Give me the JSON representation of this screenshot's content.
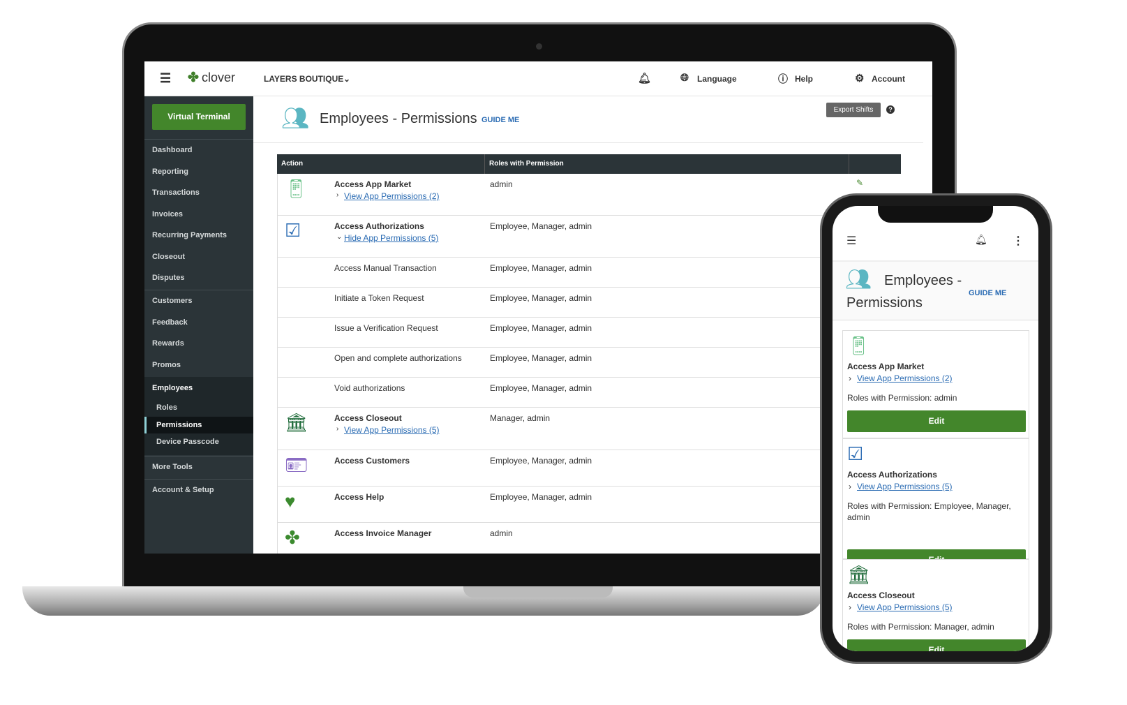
{
  "colors": {
    "brand_green": "#43862b",
    "sidebar": "#2b3438",
    "link": "#2a6bb3"
  },
  "topbar": {
    "merchant": "LAYERS BOUTIQUE",
    "logo": "clover",
    "language": "Language",
    "help": "Help",
    "account": "Account"
  },
  "sidebar": {
    "virtual_terminal": "Virtual Terminal",
    "items": [
      "Dashboard",
      "Reporting",
      "Transactions",
      "Invoices",
      "Recurring Payments",
      "Closeout",
      "Disputes",
      "Customers",
      "Feedback",
      "Rewards",
      "Promos",
      "Employees",
      "Roles",
      "Permissions",
      "Device Passcode",
      "More Tools",
      "Account & Setup"
    ],
    "active": "Permissions"
  },
  "page": {
    "title": "Employees - Permissions",
    "guide": "GUIDE ME",
    "export": "Export Shifts",
    "help_icon": "?"
  },
  "table": {
    "headers": [
      "Action",
      "Roles with Permission"
    ],
    "rows": [
      {
        "action": "Access App Market",
        "roles": "admin",
        "link": "View App Permissions (2)",
        "icon": "app-market"
      },
      {
        "action": "Access Authorizations",
        "roles": "Employee, Manager, admin",
        "link": "Hide App Permissions (5)",
        "icon": "authorization"
      },
      {
        "action": "Access Manual Transaction",
        "roles": "Employee, Manager, admin"
      },
      {
        "action": "Initiate a Token Request",
        "roles": "Employee, Manager, admin"
      },
      {
        "action": "Issue a Verification Request",
        "roles": "Employee, Manager, admin"
      },
      {
        "action": "Open and complete authorizations",
        "roles": "Employee, Manager, admin"
      },
      {
        "action": "Void authorizations",
        "roles": "Employee, Manager, admin"
      },
      {
        "action": "Access Closeout",
        "roles": "Manager, admin",
        "link": "View App Permissions (5)",
        "icon": "bank"
      },
      {
        "action": "Access Customers",
        "roles": "Employee, Manager, admin",
        "icon": "id-card"
      },
      {
        "action": "Access Help",
        "roles": "Employee, Manager, admin",
        "icon": "heart"
      },
      {
        "action": "Access Invoice Manager",
        "roles": "admin",
        "icon": "clover"
      }
    ]
  },
  "mobile": {
    "title1": "Employees -",
    "title2": "Permissions",
    "guide": "GUIDE ME",
    "edit": "Edit",
    "cards": [
      {
        "title": "Access App Market",
        "link": "View App Permissions (2)",
        "roles": "Roles with Permission: admin"
      },
      {
        "title": "Access Authorizations",
        "link": "View App Permissions (5)",
        "roles": "Roles with Permission: Employee, Manager, admin"
      },
      {
        "title": "Access Closeout",
        "link": "View App Permissions (5)",
        "roles": "Roles with Permission: Manager, admin"
      }
    ]
  }
}
